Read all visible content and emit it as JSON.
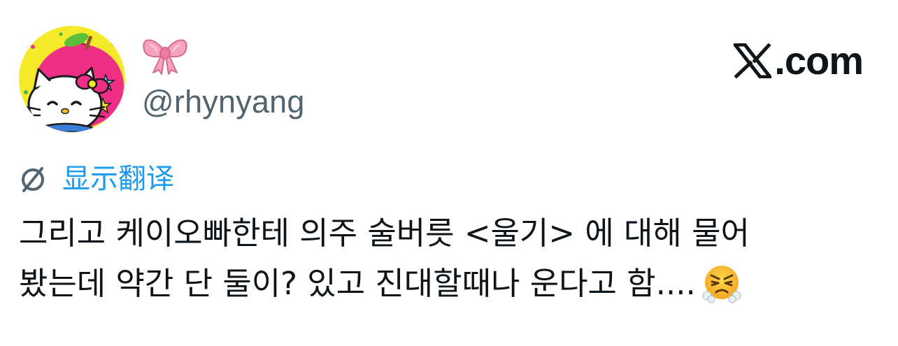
{
  "author": {
    "display_name_emoji": "ribbon-emoji",
    "handle": "@rhynyang",
    "avatar": "hello-kitty-avatar"
  },
  "brand": {
    "icon": "x-logo-icon",
    "label": ".com"
  },
  "translate": {
    "icon": "globe-slash-icon",
    "label": "显示翻译",
    "color": "#1d9bf0"
  },
  "tweet": {
    "line1": "그리고 케이오빠한테 의주 술버릇 <울기> 에 대해 물어",
    "line2": "봤는데 약간 단 둘이? 있고 진대할때나 운다고 함....",
    "trailing_emoji": "huffing-face-emoji"
  },
  "colors": {
    "text": "#0f1419",
    "secondary": "#536471",
    "link": "#1d9bf0"
  }
}
